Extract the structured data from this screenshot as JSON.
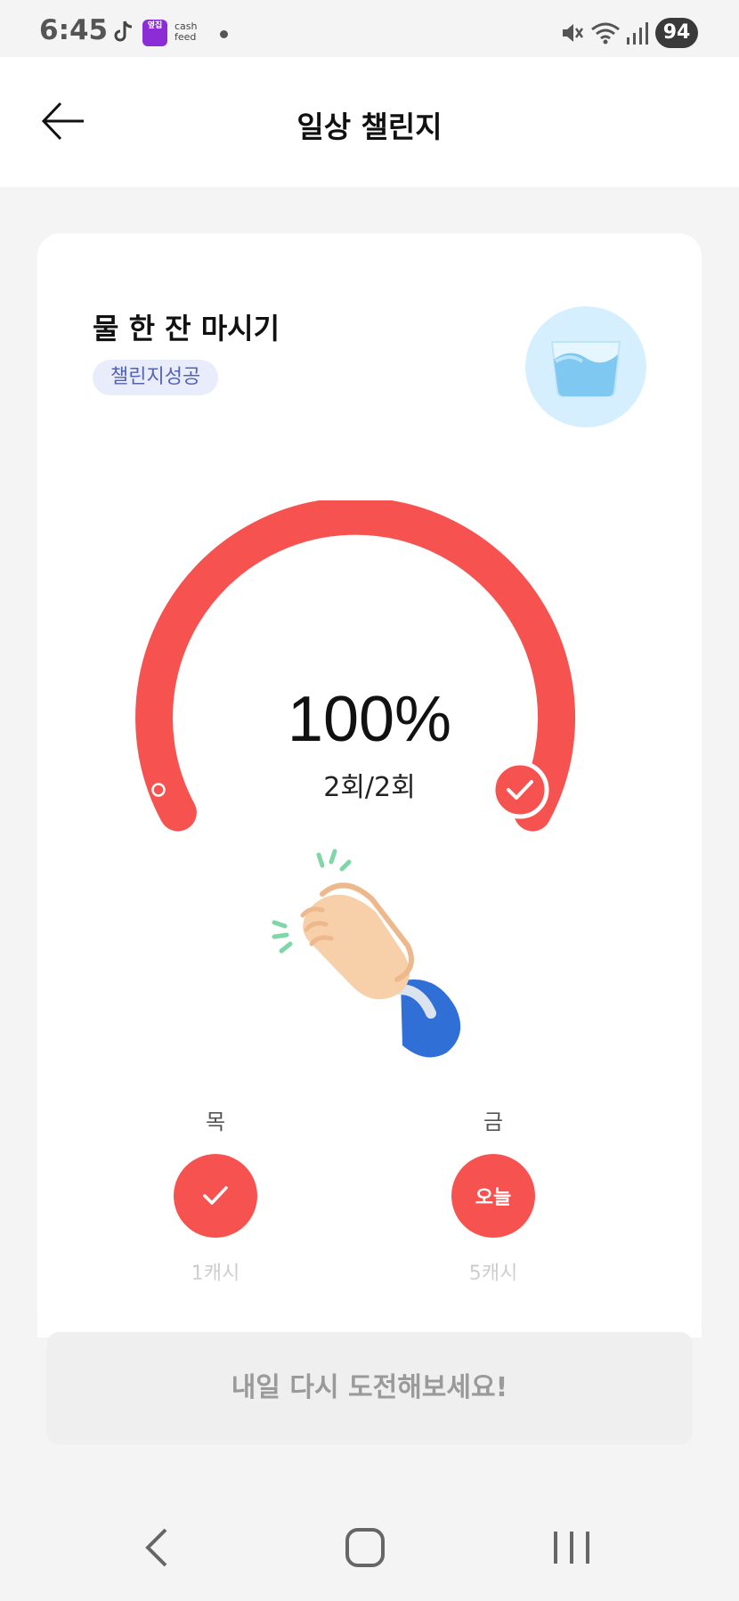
{
  "status_bar": {
    "time": "6:45",
    "notification_icons": [
      "tiktok-icon",
      "cashfeed-icon",
      "dot-icon"
    ],
    "cashfeed_label": "cash feed",
    "cashfeed_badge": "옆집",
    "system_icons": [
      "mute-icon",
      "wifi-icon",
      "signal-icon"
    ],
    "battery": "94"
  },
  "header": {
    "back_icon": "arrow-left-icon",
    "title": "일상 챌린지"
  },
  "challenge": {
    "title": "물 한 잔 마시기",
    "status": "챌린지성공",
    "icon": "water-glass-icon",
    "progress_percent_text": "100%",
    "progress": 1.0,
    "count_text": "2회/2회",
    "celebration_icon": "clapping-hands-icon"
  },
  "days": [
    {
      "label": "목",
      "state": "completed",
      "icon": "check-icon",
      "reward": "1캐시"
    },
    {
      "label": "금",
      "state": "today",
      "text": "오늘",
      "reward": "5캐시"
    }
  ],
  "retry_button": {
    "label": "내일 다시 도전해보세요!"
  },
  "nav_bar": {
    "items": [
      "back-nav-icon",
      "home-nav-icon",
      "recents-nav-icon"
    ]
  },
  "colors": {
    "accent": "#f65350",
    "badge_bg": "#e9ecfb",
    "badge_text": "#5562b3",
    "page_bg": "#f4f4f4"
  }
}
